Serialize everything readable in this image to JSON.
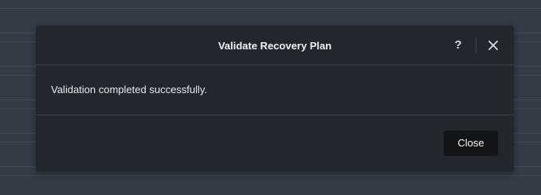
{
  "dialog": {
    "title": "Validate Recovery Plan",
    "help_icon": "question-mark-icon",
    "help_symbol": "?",
    "close_icon": "close-x-icon",
    "message": "Validation completed successfully.",
    "close_button_label": "Close"
  },
  "colors": {
    "backdrop": "#3a414a",
    "dialog_bg": "#22272e",
    "divider": "#3a414a",
    "button_bg": "#121417",
    "text": "#ffffff"
  }
}
